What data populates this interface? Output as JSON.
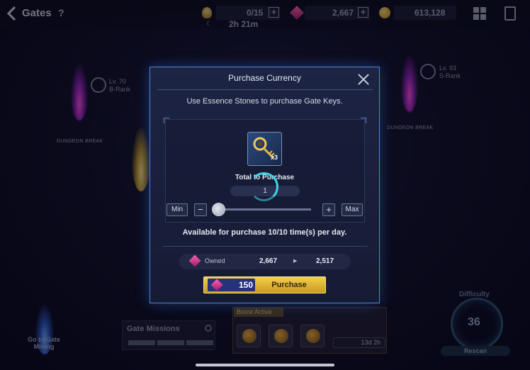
{
  "header": {
    "title": "Gates",
    "help": "?",
    "keys": "0/15",
    "keys_timer": "2h 21m",
    "essence_stones": "2,667",
    "gold": "613,128",
    "plus": "+"
  },
  "map": {
    "gates": [
      {
        "level": "Lv. 70",
        "rank": "B-Rank",
        "tag": "DUNGEON BREAK"
      },
      {
        "level": "Lv. 93",
        "rank": "S-Rank",
        "tag": "DUNGEON BREAK"
      }
    ],
    "mining_label": "Go to Gate Mining",
    "gate_missions_label": "Gate Missions",
    "boost_label": "Boost Active",
    "boost_timer": "13d 2h",
    "difficulty_label": "Difficulty",
    "difficulty_value": "36",
    "rescan_label": "Rescan"
  },
  "modal": {
    "title": "Purchase Currency",
    "subtitle": "Use Essence Stones to purchase Gate Keys.",
    "item_icon": "gate-key-icon",
    "item_quantity": "x3",
    "total_label": "Total to Purchase",
    "amount": "1",
    "min_label": "Min",
    "max_label": "Max",
    "minus": "−",
    "plus": "+",
    "slider_fraction": 0.0,
    "availability": "Available for purchase 10/10 time(s) per day.",
    "owned_label": "Owned",
    "owned_value": "2,667",
    "after_value": "2,517",
    "purchase_cost": "150",
    "purchase_label": "Purchase"
  },
  "colors": {
    "accent_border": "#4d86d8",
    "purchase_button": "#e4b937",
    "spinner": "#3fd4e6",
    "essence_stone": "#d85bd6"
  }
}
